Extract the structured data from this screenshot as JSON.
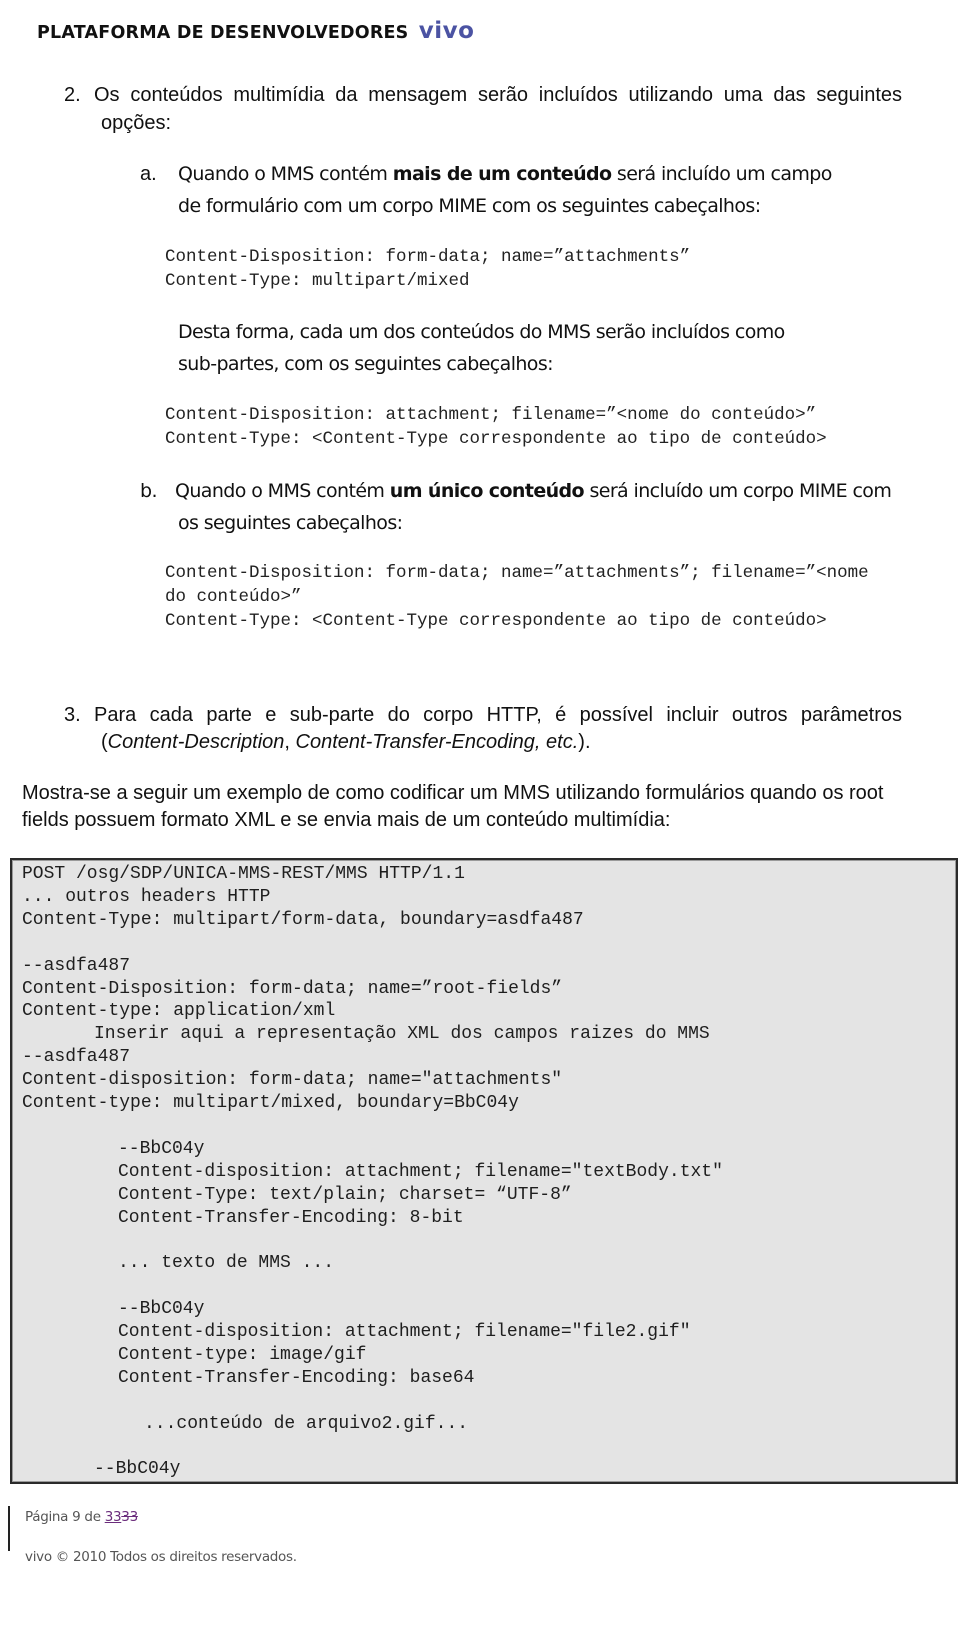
{
  "header": {
    "title": "PLATAFORMA DE DESENVOLVEDORES",
    "logo": "vivo",
    "logo_color": "#4b53a3"
  },
  "item2": {
    "number": "2.",
    "line1": "Os conteúdos multimídia da mensagem serão incluídos utilizando uma das seguintes",
    "line2": "opções:"
  },
  "option_a": {
    "label": "a.",
    "line1_pre": "Quando o MMS contém ",
    "line1_bold": "mais de um conteúdo",
    "line1_post": " será incluído um campo",
    "line2": "de formulário com um corpo MIME com os seguintes cabeçalhos:",
    "code": [
      "Content-Disposition: form-data; name=”attachments”",
      "Content-Type: multipart/mixed"
    ],
    "desta_line1": "Desta forma, cada um dos conteúdos do MMS serão incluídos como",
    "desta_line2": "sub-partes, com os seguintes cabeçalhos:",
    "subpart_code": [
      "Content-Disposition: attachment; filename=”<nome do conteúdo>”",
      "Content-Type: <Content-Type correspondente ao tipo de conteúdo>"
    ]
  },
  "option_b": {
    "label": "b.",
    "line1_pre": "Quando o MMS contém ",
    "line1_bold": "um único conteúdo",
    "line1_post": " será incluído um corpo MIME com",
    "line2": "os seguintes cabeçalhos:",
    "code": [
      "Content-Disposition: form-data; name=”attachments”; filename=”<nome",
      "do conteúdo>”",
      "Content-Type: <Content-Type correspondente ao tipo de conteúdo>"
    ]
  },
  "item3": {
    "number": "3.",
    "line1": "Para cada parte e sub-parte do corpo HTTP, é possível incluir outros parâmetros",
    "line2_open": "(",
    "line2_italic1": "Content-Description",
    "line2_sep": ", ",
    "line2_italic2": "Content-Transfer-Encoding, etc.",
    "line2_close": ")."
  },
  "intro": {
    "line1": "Mostra-se a seguir um exemplo de como codificar um MMS utilizando formulários quando os root",
    "line2": "fields possuem formato XML e se envia mais de um conteúdo multimídia:"
  },
  "example_code": {
    "background": "#e4e4e4",
    "lines": [
      {
        "indent": 0,
        "text": "POST /osg/SDP/UNICA-MMS-REST/MMS HTTP/1.1"
      },
      {
        "indent": 0,
        "text": "... outros headers HTTP"
      },
      {
        "indent": 0,
        "text": "Content-Type: multipart/form-data, boundary=asdfa487"
      },
      {
        "indent": 0,
        "text": ""
      },
      {
        "indent": 0,
        "text": "--asdfa487"
      },
      {
        "indent": 0,
        "text": "Content-Disposition: form-data; name=”root-fields”"
      },
      {
        "indent": 0,
        "text": "Content-type: application/xml"
      },
      {
        "indent": 1,
        "text": "Inserir aqui a representação XML dos campos raizes do MMS"
      },
      {
        "indent": 0,
        "text": "--asdfa487"
      },
      {
        "indent": 0,
        "text": "Content-disposition: form-data; name=\"attachments\""
      },
      {
        "indent": 0,
        "text": "Content-type: multipart/mixed, boundary=BbC04y"
      },
      {
        "indent": 0,
        "text": ""
      },
      {
        "indent": 2,
        "text": "--BbC04y"
      },
      {
        "indent": 2,
        "text": "Content-disposition: attachment; filename=\"textBody.txt\""
      },
      {
        "indent": 2,
        "text": "Content-Type: text/plain; charset= “UTF-8”"
      },
      {
        "indent": 2,
        "text": "Content-Transfer-Encoding: 8-bit"
      },
      {
        "indent": 2,
        "text": ""
      },
      {
        "indent": 2,
        "text": "... texto de MMS ..."
      },
      {
        "indent": 2,
        "text": ""
      },
      {
        "indent": 2,
        "text": "--BbC04y"
      },
      {
        "indent": 2,
        "text": "Content-disposition: attachment; filename=\"file2.gif\""
      },
      {
        "indent": 2,
        "text": "Content-type: image/gif"
      },
      {
        "indent": 2,
        "text": "Content-Transfer-Encoding: base64"
      },
      {
        "indent": 2,
        "text": ""
      },
      {
        "indent": 3,
        "text": "...conteúdo de arquivo2.gif..."
      },
      {
        "indent": 3,
        "text": ""
      },
      {
        "indent": 1,
        "text": "--BbC04y"
      }
    ]
  },
  "footer": {
    "page_prefix": "Página 9 de ",
    "page_total_inserted": "33",
    "page_total_deleted": "33",
    "tracked_change_color": "#6b2d7c",
    "copyright": "vivo © 2010 Todos os direitos reservados."
  }
}
